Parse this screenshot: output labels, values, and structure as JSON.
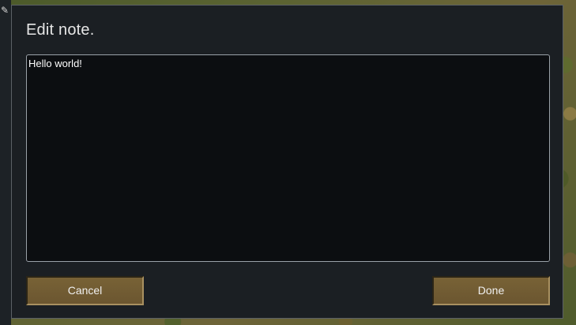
{
  "dialog": {
    "title": "Edit note.",
    "note_text": "Hello world!",
    "cancel_label": "Cancel",
    "done_label": "Done"
  },
  "colors": {
    "dialog_bg": "#1b1f23",
    "text_area_bg": "#0c0e11",
    "button_bg": "#786236",
    "text": "#e6e6e6"
  },
  "icons": {
    "left_strip_icon": "pin-icon"
  }
}
